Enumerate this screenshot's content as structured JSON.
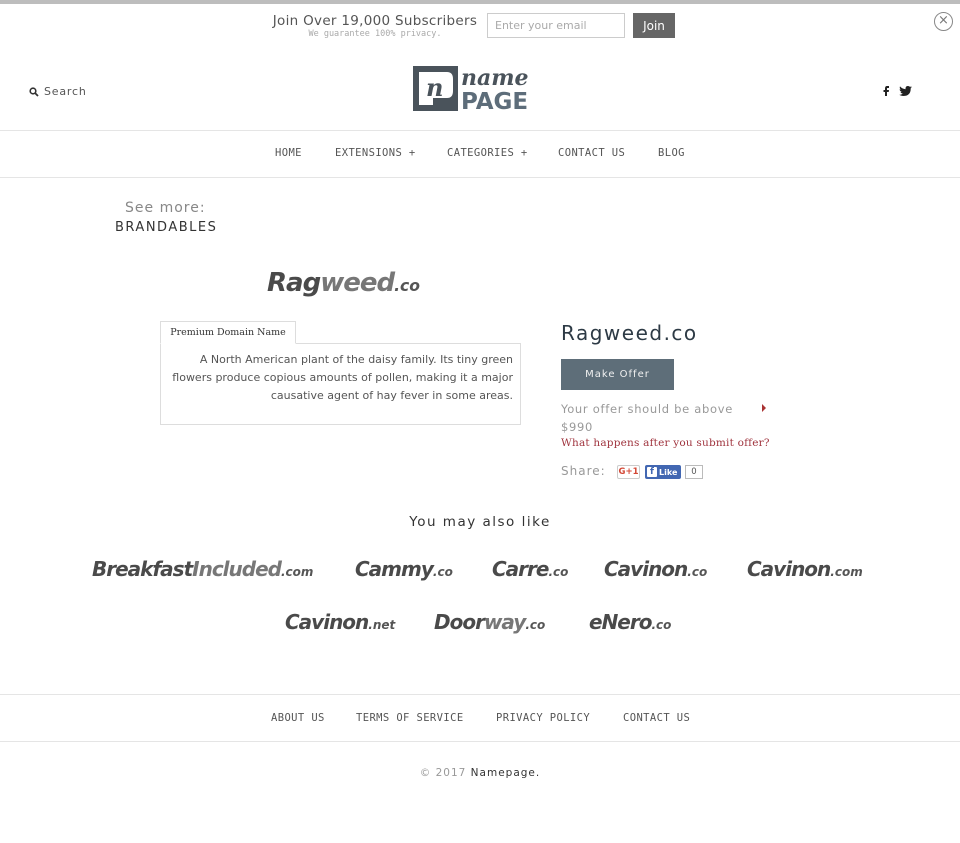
{
  "subscribe": {
    "title": "Join Over 19,000 Subscribers",
    "note": "We guarantee 100% privacy.",
    "email_placeholder": "Enter your email",
    "join_label": "Join",
    "close_icon": "×"
  },
  "header": {
    "search_label": "Search",
    "logo_top": "name",
    "logo_bottom": "PAGE",
    "logo_mark": "n",
    "social": [
      "facebook",
      "twitter"
    ]
  },
  "nav": {
    "items": [
      {
        "label": "HOME"
      },
      {
        "label": "EXTENSIONS +"
      },
      {
        "label": "CATEGORIES +"
      },
      {
        "label": "CONTACT US"
      },
      {
        "label": "BLOG"
      }
    ]
  },
  "see_more": {
    "label": "See more:",
    "link": "BRANDABLES"
  },
  "domain": {
    "logo_part1": "Rag",
    "logo_part2": "weed",
    "logo_tld": ".co",
    "name": "Ragweed.co",
    "tab_label": "Premium Domain Name",
    "description": "A North American plant of the daisy family. Its tiny green flowers produce copious amounts of pollen, making it a major causative agent of hay fever in some areas.",
    "make_offer_label": "Make Offer",
    "offer_note": "Your offer should be above $990",
    "what_happens_link": "What happens after you submit offer?",
    "share_label": "Share:",
    "gplus_label": "G+1",
    "fb_like_label": "Like",
    "fb_count": "0"
  },
  "recommendations": {
    "heading": "You may also like",
    "items": [
      {
        "part1": "Breakfast",
        "part2": "Included",
        "tld": ".com"
      },
      {
        "part1": "Cammy",
        "part2": "",
        "tld": ".co"
      },
      {
        "part1": "Carre",
        "part2": "",
        "tld": ".co"
      },
      {
        "part1": "Cavinon",
        "part2": "",
        "tld": ".co"
      },
      {
        "part1": "Cavinon",
        "part2": "",
        "tld": ".com"
      },
      {
        "part1": "Cavinon",
        "part2": "",
        "tld": ".net"
      },
      {
        "part1": "Door",
        "part2": "way",
        "tld": ".co"
      },
      {
        "part1": "eNero",
        "part2": "",
        "tld": ".co"
      }
    ]
  },
  "footer": {
    "links": [
      {
        "label": "ABOUT US"
      },
      {
        "label": "TERMS OF SERVICE"
      },
      {
        "label": "PRIVACY POLICY"
      },
      {
        "label": "CONTACT US"
      }
    ],
    "copyright_prefix": "© 2017",
    "copyright_brand": "Namepage."
  }
}
